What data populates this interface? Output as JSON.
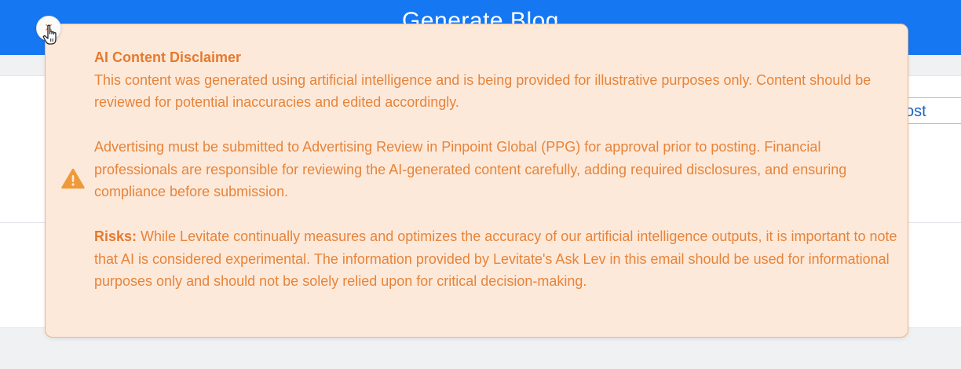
{
  "header": {
    "title": "Generate Blog"
  },
  "toolbar": {
    "blog_post_label": "g Post"
  },
  "disclaimer": {
    "title": "AI Content Disclaimer",
    "paragraph1": "This content was generated using artificial intelligence and is being provided for illustrative purposes only. Content should be reviewed for potential inaccuracies and edited accordingly.",
    "paragraph2": "Advertising must be submitted to Advertising Review in Pinpoint Global (PPG) for approval prior to posting. Financial professionals are responsible for reviewing the AI-generated content carefully, adding required disclosures, and ensuring compliance before submission.",
    "risks_label": "Risks:",
    "risks_text": "While Levitate continually measures and optimizes the accuracy of our artificial intelligence outputs, it is important to note that AI is considered experimental. The information provided by Levitate's Ask Lev in this email should be used for informational purposes only and should not be solely relied upon for critical decision-making.",
    "icon": "warning-icon",
    "close_glyph": "×"
  },
  "colors": {
    "header_blue": "#1677f2",
    "disclaimer_bg": "#fde9da",
    "disclaimer_border": "#f2b486",
    "disclaimer_text": "#e6843a",
    "warning_orange": "#ef9a3a"
  }
}
